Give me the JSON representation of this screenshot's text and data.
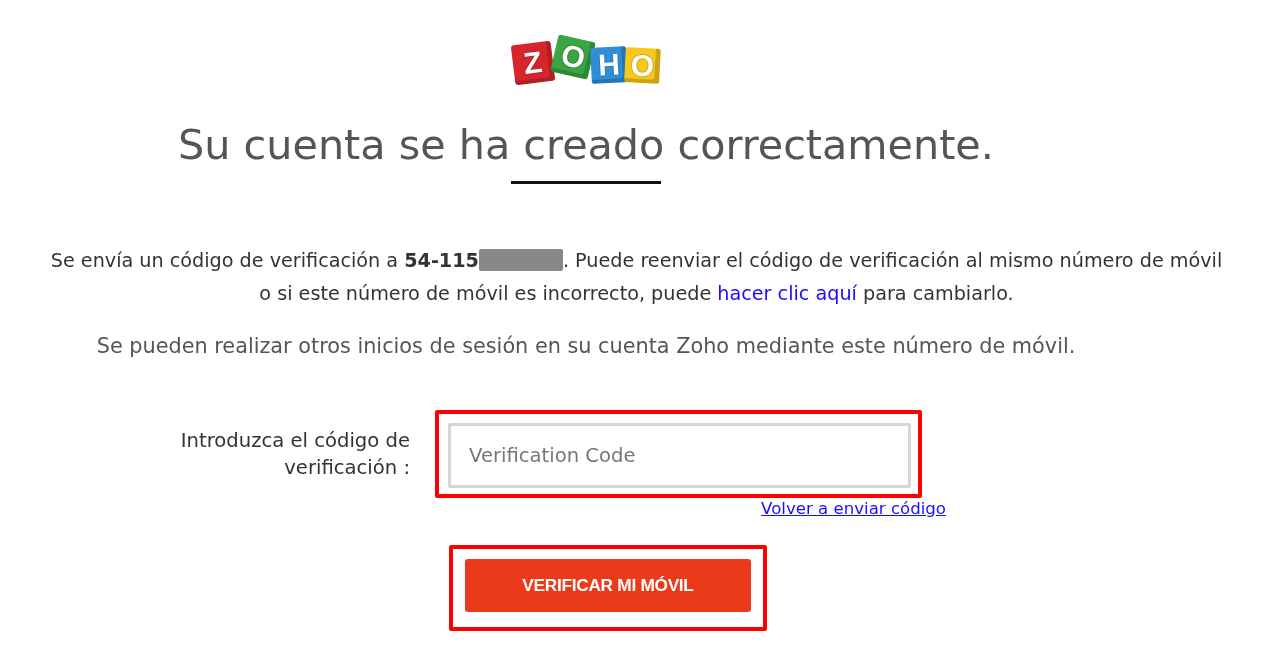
{
  "logo": {
    "tiles": [
      {
        "letter": "Z",
        "color": "#d6262c"
      },
      {
        "letter": "O",
        "color": "#39a544"
      },
      {
        "letter": "H",
        "color": "#2e8fd8"
      },
      {
        "letter": "O",
        "color": "#f8c91b"
      }
    ]
  },
  "heading": "Su cuenta se ha creado correctamente.",
  "notice": {
    "line_1": {
      "text": "Se envía un código de verificación a **54-115**",
      "redacted": true,
      "text_after": ". Puede reenviar el código de verificación al mismo número de móvil"
    },
    "line_2": {
      "text": "o si este número de móvil es incorrecto, puede",
      "link": "hacer clic aquí",
      "text_after": "para cambiarlo."
    }
  },
  "sign_in_note": "Se pueden realizar otros inicios de sesión en su cuenta Zoho mediante este número de móvil.",
  "form": {
    "label": "Introduzca el código de verificación :",
    "code_field": {
      "placeholder": "Verification Code",
      "highlighted": true
    },
    "resend_link": "Volver a enviar código",
    "verify_button": {
      "label": "VERIFICAR MI MÓVIL",
      "highlighted": true
    }
  }
}
